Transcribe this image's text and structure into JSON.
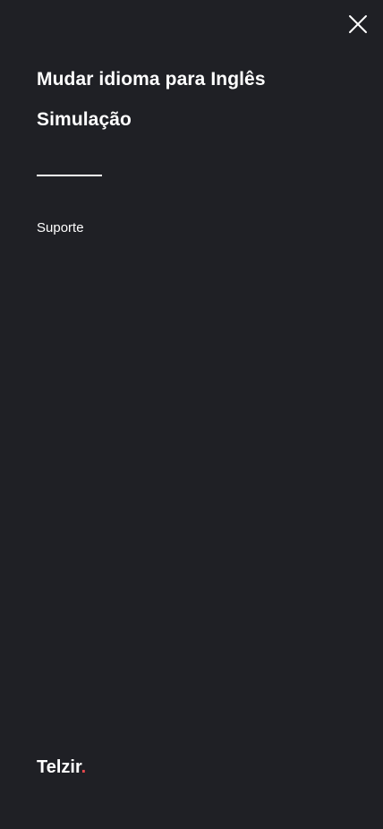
{
  "menu": {
    "items": [
      {
        "label": "Mudar idioma para Inglês"
      },
      {
        "label": "Simulação"
      }
    ],
    "support_label": "Suporte"
  },
  "header": {
    "close_icon": "close-icon"
  },
  "footer": {
    "brand_name": "Telzir",
    "brand_dot": "."
  },
  "colors": {
    "background": "#1f2025",
    "text": "#ffffff",
    "accent": "#e5484d"
  }
}
